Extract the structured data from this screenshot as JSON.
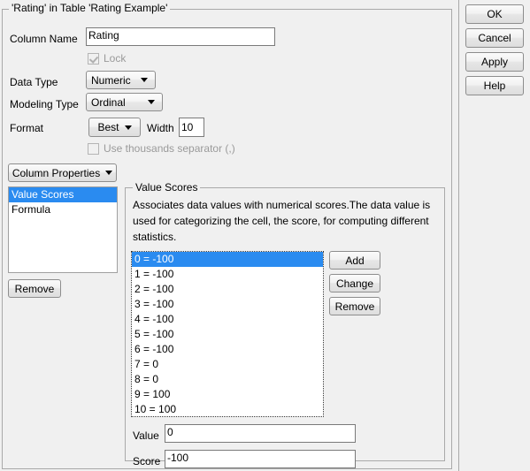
{
  "dialog": {
    "group_title": "'Rating' in Table 'Rating Example'"
  },
  "fields": {
    "column_name_label": "Column Name",
    "column_name_value": "Rating",
    "lock_label": "Lock",
    "lock_checked": true,
    "data_type_label": "Data Type",
    "data_type_value": "Numeric",
    "modeling_type_label": "Modeling Type",
    "modeling_type_value": "Ordinal",
    "format_label": "Format",
    "format_value": "Best",
    "width_label": "Width",
    "width_value": "10",
    "thousands_label": "Use thousands separator (,)",
    "thousands_checked": false
  },
  "column_properties": {
    "button_label": "Column Properties",
    "items": [
      {
        "label": "Value Scores",
        "selected": true
      },
      {
        "label": "Formula",
        "selected": false
      }
    ],
    "remove_label": "Remove"
  },
  "value_scores": {
    "group_title": "Value Scores",
    "description": "Associates data values with numerical scores.The data value is used for categorizing the cell, the score, for computing different statistics.",
    "items": [
      {
        "label": "0 = -100",
        "selected": true
      },
      {
        "label": "1 = -100",
        "selected": false
      },
      {
        "label": "2 = -100",
        "selected": false
      },
      {
        "label": "3 = -100",
        "selected": false
      },
      {
        "label": "4 = -100",
        "selected": false
      },
      {
        "label": "5 = -100",
        "selected": false
      },
      {
        "label": "6 = -100",
        "selected": false
      },
      {
        "label": "7 = 0",
        "selected": false
      },
      {
        "label": "8 = 0",
        "selected": false
      },
      {
        "label": "9 = 100",
        "selected": false
      },
      {
        "label": "10 = 100",
        "selected": false
      }
    ],
    "add_label": "Add",
    "change_label": "Change",
    "remove_label": "Remove",
    "value_label": "Value",
    "value_input": "0",
    "score_label": "Score",
    "score_input": "-100"
  },
  "actions": {
    "ok": "OK",
    "cancel": "Cancel",
    "apply": "Apply",
    "help": "Help"
  },
  "colors": {
    "selection_blue": "#2a8bf0",
    "background": "#f0f0f0",
    "border": "#a9a9a9"
  }
}
